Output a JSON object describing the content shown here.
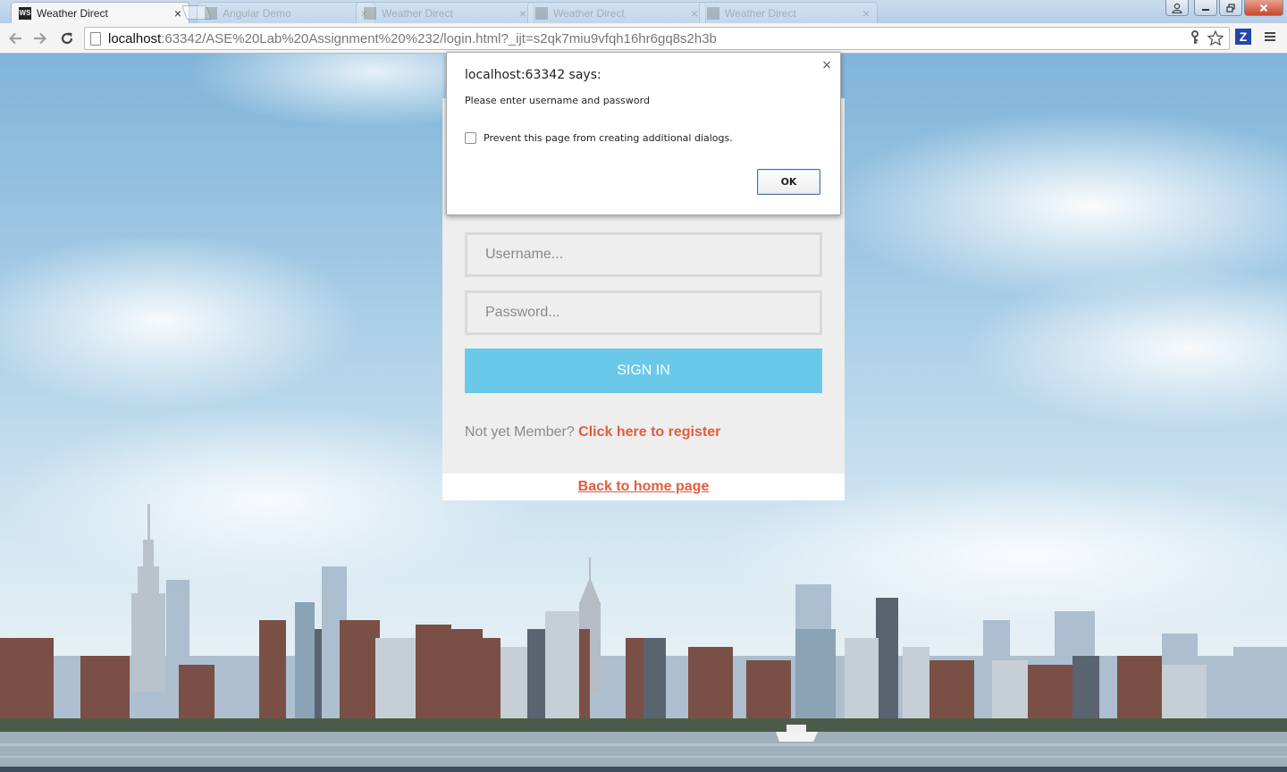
{
  "browser": {
    "tabs": [
      {
        "title": "Weather Direct",
        "favicon": "WS",
        "active": true
      },
      {
        "title": "Angular Demo",
        "active": false
      },
      {
        "title": "Weather Direct",
        "active": false
      },
      {
        "title": "Weather Direct",
        "active": false
      },
      {
        "title": "Weather Direct",
        "active": false
      }
    ],
    "tab_close_glyph": "×",
    "url_host": "localhost",
    "url_path": ":63342/ASE%20Lab%20Assignment%20%232/login.html?_ijt=s2qk7miu9vfqh16hr6gq8s2h3b",
    "extension_label": "Z"
  },
  "dialog": {
    "title": "localhost:63342 says:",
    "message": "Please enter username and password",
    "checkbox_label": "Prevent this page from creating additional dialogs.",
    "ok_label": "OK",
    "close_glyph": "×"
  },
  "login": {
    "username_placeholder": "Username...",
    "password_placeholder": "Password...",
    "signin_label": "SIGN IN",
    "register_prompt": "Not yet Member? ",
    "register_link": "Click here to register",
    "back_link": "Back to home page"
  },
  "colors": {
    "accent_button": "#6ac9e9",
    "link": "#e15d3e"
  }
}
